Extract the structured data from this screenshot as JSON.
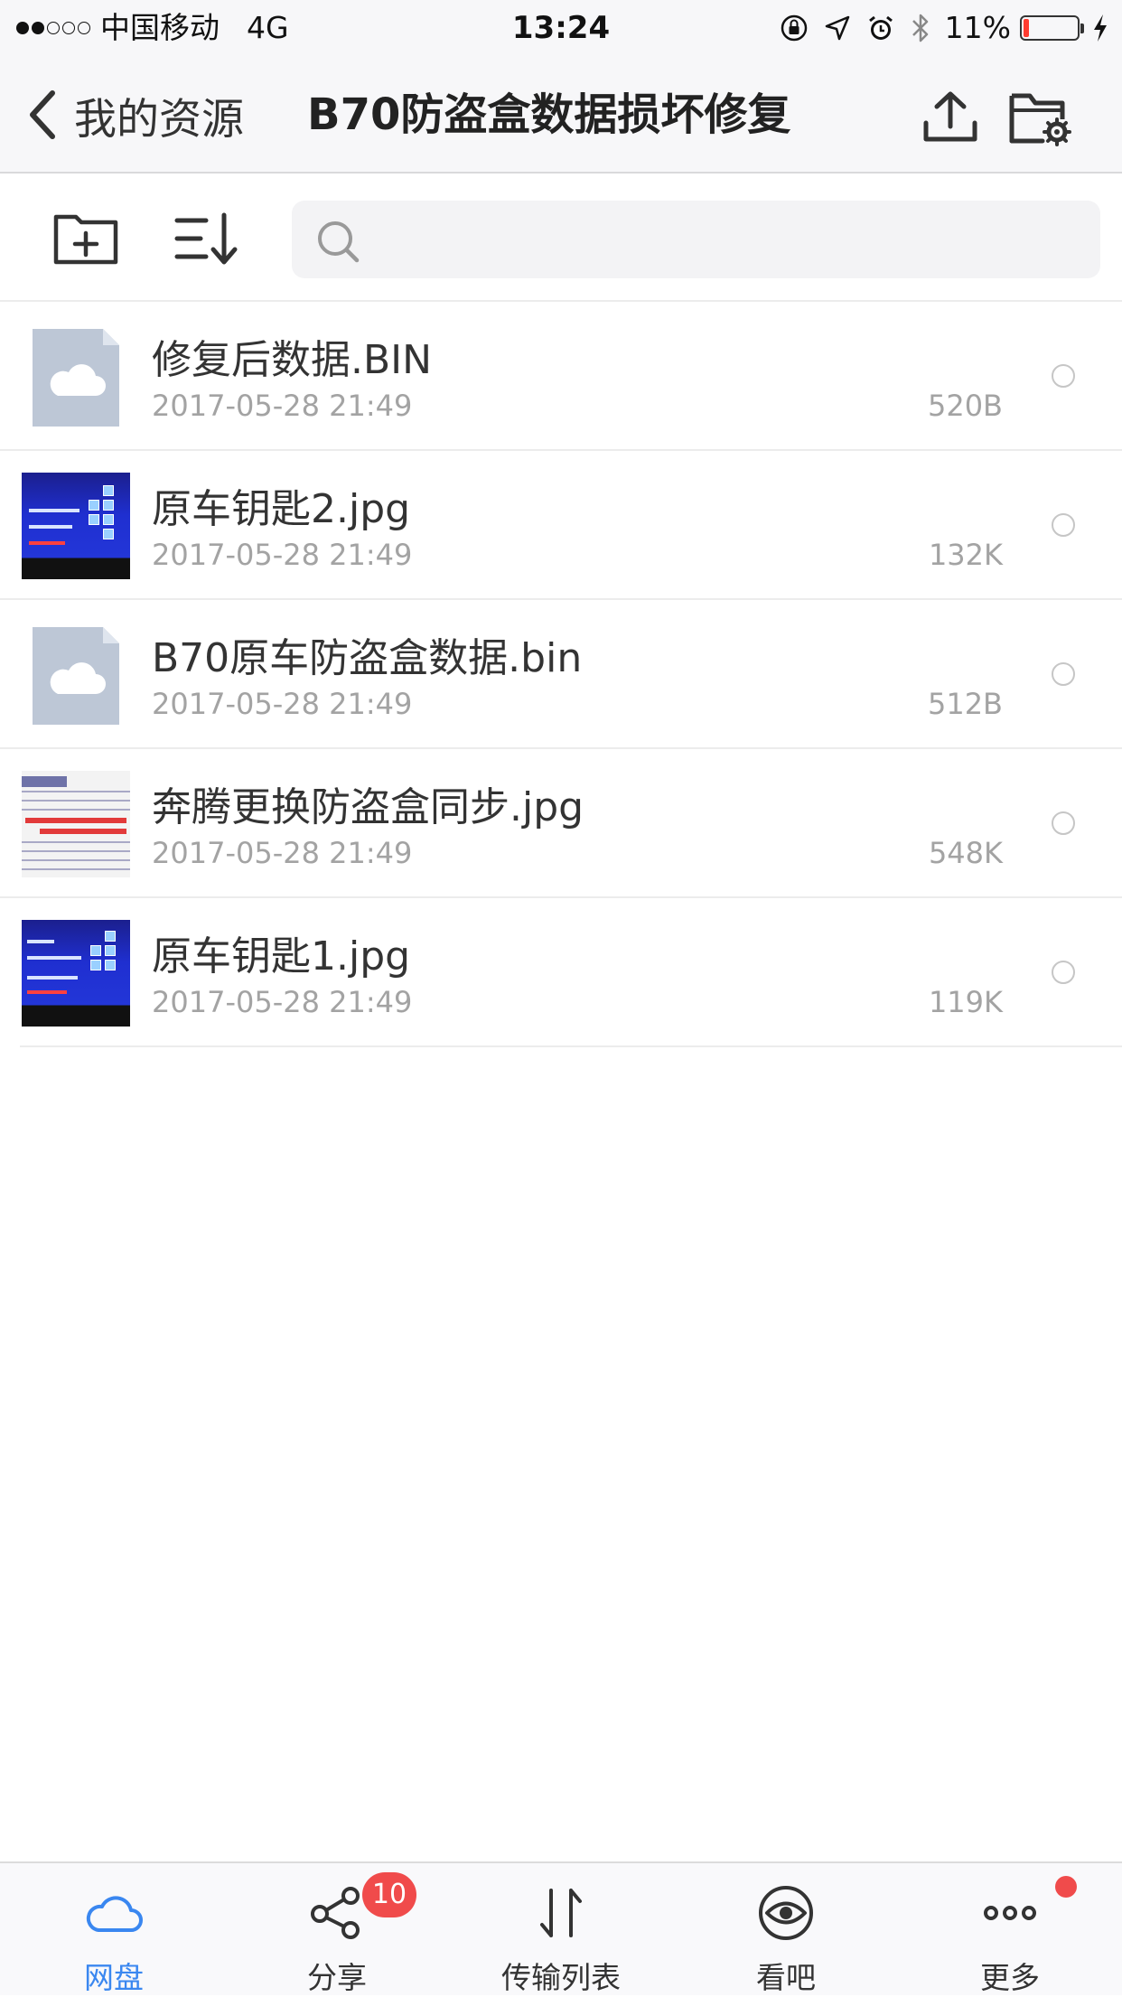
{
  "status_bar": {
    "carrier": "中国移动",
    "network": "4G",
    "time": "13:24",
    "battery_text": "11%",
    "battery_level": 0.11,
    "signal_bars_filled": 2,
    "signal_bars_total": 5
  },
  "nav": {
    "back_label": "我的资源",
    "title": "B70防盗盒数据损坏修复",
    "upload_icon": "upload-icon",
    "folder_settings_icon": "folder-settings-icon"
  },
  "toolbar": {
    "new_folder_icon": "new-folder-icon",
    "sort_icon": "sort-icon",
    "search_placeholder": ""
  },
  "files": [
    {
      "name": "修复后数据.BIN",
      "date": "2017-05-28 21:49",
      "size": "520B",
      "type": "file"
    },
    {
      "name": "原车钥匙2.jpg",
      "date": "2017-05-28 21:49",
      "size": "132K",
      "type": "image"
    },
    {
      "name": "B70原车防盗盒数据.bin",
      "date": "2017-05-28 21:49",
      "size": "512B",
      "type": "file"
    },
    {
      "name": "奔腾更换防盗盒同步.jpg",
      "date": "2017-05-28 21:49",
      "size": "548K",
      "type": "image"
    },
    {
      "name": "原车钥匙1.jpg",
      "date": "2017-05-28 21:49",
      "size": "119K",
      "type": "image"
    }
  ],
  "tabs": [
    {
      "label": "网盘",
      "icon": "cloud-icon",
      "active": true
    },
    {
      "label": "分享",
      "icon": "share-icon",
      "badge": "10"
    },
    {
      "label": "传输列表",
      "icon": "transfer-icon"
    },
    {
      "label": "看吧",
      "icon": "eye-icon"
    },
    {
      "label": "更多",
      "icon": "more-icon",
      "dot": true
    }
  ],
  "colors": {
    "accent": "#3a87f0",
    "badge": "#f04b4b",
    "battery_low": "#ff3b30",
    "doc_icon": "#bdc7d6"
  }
}
